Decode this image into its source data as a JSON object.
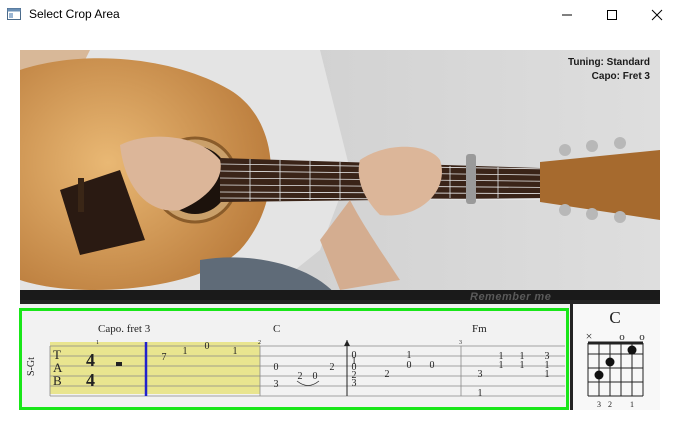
{
  "window": {
    "title": "Select Crop Area",
    "controls": [
      "minimize-icon",
      "maximize-icon",
      "close-icon"
    ]
  },
  "video": {
    "tuning": "Tuning: Standard",
    "capo_overlay": "Capo: Fret 3",
    "watermark": "Remember me"
  },
  "tab": {
    "track_label": "S-Gt",
    "clef": [
      "T",
      "A",
      "B"
    ],
    "time_sig": [
      "4",
      "4"
    ],
    "capo_text": "Capo. fret 3",
    "chords": [
      "C",
      "Fm"
    ],
    "measure_numbers": [
      "1",
      "2",
      "3"
    ],
    "frets": [
      "7",
      "1",
      "0",
      "1",
      "0",
      "2",
      "3",
      "0",
      "2",
      "0",
      "1",
      "0",
      "2",
      "3",
      "2",
      "1",
      "0",
      "0",
      "3",
      "1",
      "1",
      "1",
      "3",
      "1",
      "1",
      "1",
      "1"
    ]
  },
  "chord_diagram": {
    "name": "C",
    "markers": [
      "×",
      "o",
      "o"
    ],
    "fingering": [
      "3",
      "2",
      "1"
    ]
  },
  "colors": {
    "crop_border": "#19e619",
    "highlight": "#e9e58f",
    "playhead": "#2222cc"
  }
}
